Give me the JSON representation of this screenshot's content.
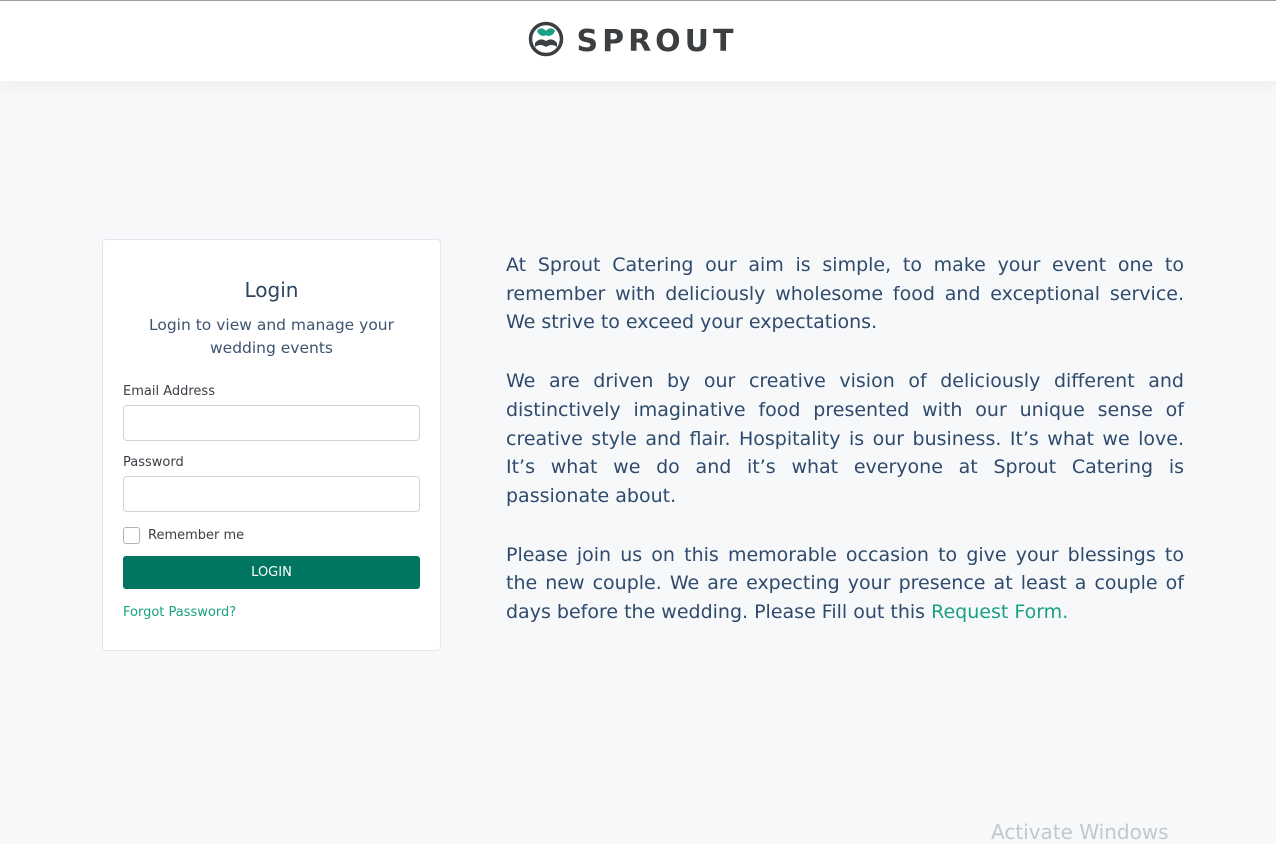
{
  "header": {
    "logo_icon": "sprout-logo-icon",
    "brand_name": "SPROUT",
    "accent_color": "#1aa083"
  },
  "login_card": {
    "title": "Login",
    "subtitle": "Login to view and manage your wedding events",
    "email_label": "Email Address",
    "email_value": "",
    "password_label": "Password",
    "password_value": "",
    "remember_label": "Remember me",
    "remember_checked": false,
    "login_button": "LOGIN",
    "forgot_link": "Forgot Password?",
    "button_color": "#007560"
  },
  "content": {
    "paragraph1": "At Sprout Catering our aim is simple, to make your event one to remember with deliciously wholesome food and exceptional service. We strive to exceed your expectations.",
    "paragraph2": "We are driven by our creative vision of deliciously different and distinctively imaginative food presented with our unique sense of creative style and flair. Hospitality is our business. It’s what we love. It’s what we do and it’s what everyone at Sprout Catering is passionate about.",
    "paragraph3_text": "Please join us on this memorable occasion to give your blessings to the new couple. We are expecting your presence at least a couple of days before the wedding. Please Fill out this",
    "request_form_link": "Request Form."
  },
  "watermark": "Activate Windows"
}
